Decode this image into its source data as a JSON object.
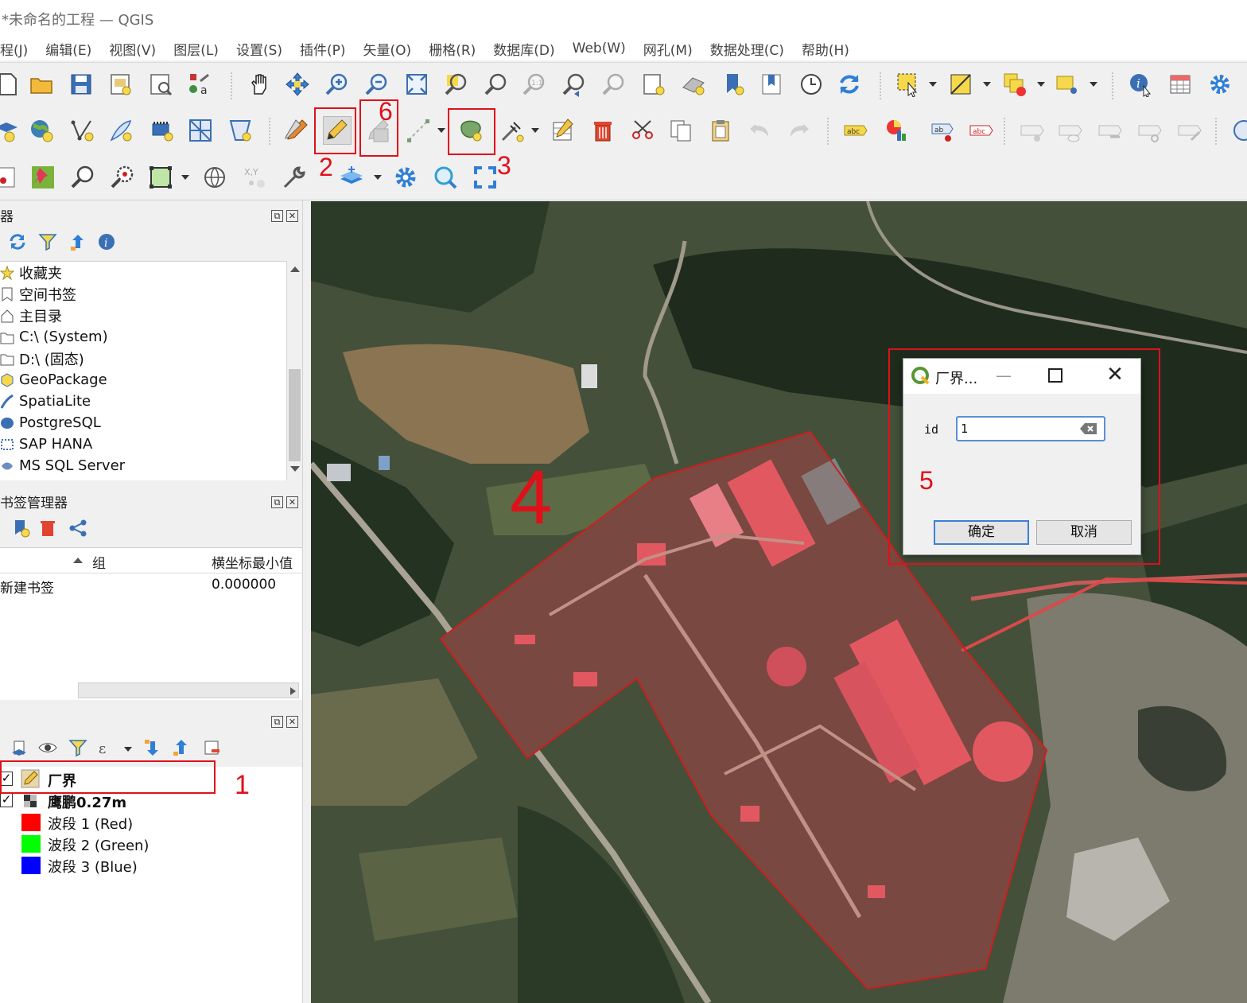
{
  "window": {
    "title": "*未命名的工程 — QGIS"
  },
  "menu": [
    "程(J)",
    "编辑(E)",
    "视图(V)",
    "图层(L)",
    "设置(S)",
    "插件(P)",
    "矢量(O)",
    "栅格(R)",
    "数据库(D)",
    "Web(W)",
    "网孔(M)",
    "数据处理(C)",
    "帮助(H)"
  ],
  "browser_panel": {
    "title": "器",
    "items": [
      "收藏夹",
      "空间书签",
      "主目录",
      "C:\\ (System)",
      "D:\\ (固态)",
      "GeoPackage",
      "SpatiaLite",
      "PostgreSQL",
      "SAP HANA",
      "MS SQL Server"
    ]
  },
  "bookmark_panel": {
    "title": "书签管理器",
    "columns": [
      "",
      "组",
      "横坐标最小值"
    ],
    "rows": [
      {
        "name": "新建书签",
        "group": "",
        "xmin": "0.000000"
      }
    ]
  },
  "layers_panel": {
    "title": "",
    "layers": [
      {
        "name": "厂界",
        "checked": true,
        "bold": true
      },
      {
        "name": "鹰鹏0.27m",
        "checked": true,
        "bold": true
      }
    ],
    "bands": [
      {
        "name": "波段 1 (Red)",
        "color": "#ff0000"
      },
      {
        "name": "波段 2 (Green)",
        "color": "#00ff00"
      },
      {
        "name": "波段 3 (Blue)",
        "color": "#0000ff"
      }
    ]
  },
  "dialog": {
    "title": "厂界...",
    "field_label": "id",
    "field_value": "1",
    "ok_label": "确定",
    "cancel_label": "取消"
  },
  "annotations": {
    "n1": "1",
    "n2": "2",
    "n3": "3",
    "n4": "4",
    "n5": "5",
    "n6": "6",
    "color": "#e0101a"
  },
  "colors": {
    "accent": "#3c7fd8",
    "polygon_stroke": "#cc1f1f",
    "polygon_fill": "rgba(230,70,70,0.30)"
  },
  "icons": {
    "toolbar1": [
      "new-project-icon",
      "open-project-icon",
      "save-project-icon",
      "print-layout-icon",
      "layout-manager-icon",
      "style-manager-icon",
      "pan-icon",
      "pan-to-selection-icon",
      "zoom-in-icon",
      "zoom-out-icon",
      "zoom-full-icon",
      "zoom-to-selection-icon",
      "zoom-to-layer-icon",
      "zoom-native-icon",
      "zoom-last-icon",
      "zoom-next-icon",
      "new-map-view-icon",
      "new-3d-view-icon",
      "new-bookmark-icon",
      "show-bookmarks-icon",
      "temporal-controller-icon",
      "refresh-icon",
      "select-features-icon",
      "deselect-icon",
      "select-by-value-icon",
      "select-by-location-icon",
      "identify-icon",
      "attribute-table-icon",
      "settings-gear-icon"
    ],
    "toolbar2": [
      "add-layer-icon",
      "add-raster-icon",
      "add-vector-icon",
      "digitize-icon",
      "add-wms-icon",
      "add-mesh-icon",
      "add-virtual-layer-icon",
      "edits-icon",
      "toggle-editing-pencil-icon",
      "save-edits-icon",
      "digitize-line-icon",
      "add-polygon-icon",
      "vertex-tool-icon",
      "modify-attributes-icon",
      "delete-selected-icon",
      "cut-features-icon",
      "copy-features-icon",
      "paste-features-icon",
      "undo-icon",
      "redo-icon",
      "label-toolbar-icon",
      "diagram-icon",
      "pin-labels-icon",
      "change-label-icon",
      "label-tools-icon"
    ],
    "toolbar3": [
      "measure-icon",
      "pin-icon",
      "find-icon",
      "zoom-locate-icon",
      "select-extent-icon",
      "globe-icon",
      "xy-coordinate-icon",
      "wrench-icon",
      "layer-stack-icon",
      "processing-gear-icon",
      "search-magnifier-icon",
      "full-extent-icon"
    ]
  }
}
